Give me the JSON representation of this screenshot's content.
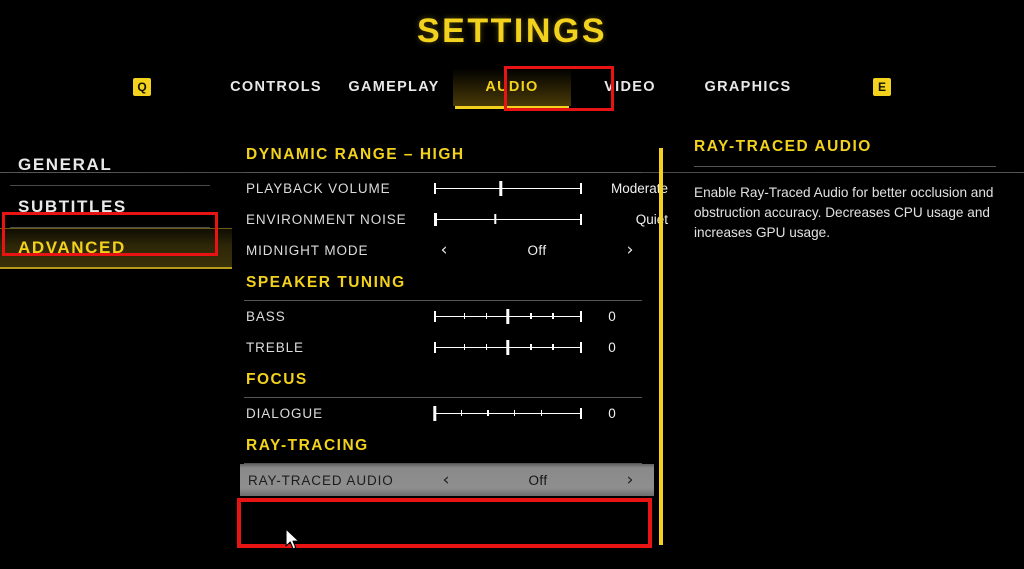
{
  "header": {
    "title": "SETTINGS"
  },
  "tabbar": {
    "left_key": "Q",
    "right_key": "E",
    "tabs": [
      {
        "label": "CONTROLS",
        "active": false
      },
      {
        "label": "GAMEPLAY",
        "active": false
      },
      {
        "label": "AUDIO",
        "active": true
      },
      {
        "label": "VIDEO",
        "active": false
      },
      {
        "label": "GRAPHICS",
        "active": false
      }
    ]
  },
  "sidebar": {
    "items": [
      {
        "label": "GENERAL",
        "active": false
      },
      {
        "label": "SUBTITLES",
        "active": false
      },
      {
        "label": "ADVANCED",
        "active": true
      }
    ]
  },
  "main": {
    "sections": [
      {
        "heading": "DYNAMIC RANGE – HIGH",
        "rows": [
          {
            "label": "PLAYBACK VOLUME",
            "type": "slider",
            "value": "Moderate",
            "percent": 45
          },
          {
            "label": "ENVIRONMENT NOISE",
            "type": "slider",
            "value": "Quiet",
            "percent": 42
          },
          {
            "label": "MIDNIGHT MODE",
            "type": "stepper",
            "value": "Off"
          }
        ]
      },
      {
        "heading": "SPEAKER TUNING",
        "rows": [
          {
            "label": "BASS",
            "type": "slider-ticks",
            "value": "0",
            "percent": 50
          },
          {
            "label": "TREBLE",
            "type": "slider-ticks",
            "value": "0",
            "percent": 50
          }
        ]
      },
      {
        "heading": "FOCUS",
        "rows": [
          {
            "label": "DIALOGUE",
            "type": "slider-ticks",
            "value": "0",
            "percent": 0
          }
        ]
      },
      {
        "heading": "RAY-TRACING",
        "rows": [
          {
            "label": "RAY-TRACED AUDIO",
            "type": "stepper",
            "value": "Off",
            "highlighted": true
          }
        ]
      }
    ]
  },
  "info": {
    "title": "RAY-TRACED AUDIO",
    "description": "Enable Ray-Traced Audio for better occlusion and obstruction accuracy. Decreases CPU usage and increases GPU usage."
  },
  "colors": {
    "accent_yellow": "#f2d21c",
    "annotation_red": "#e81414",
    "background": "#000000",
    "highlight_gray": "#8e8e8e"
  }
}
